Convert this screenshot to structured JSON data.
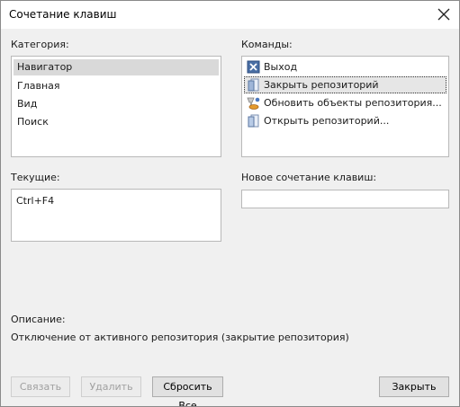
{
  "window": {
    "title": "Сочетание клавиш"
  },
  "category": {
    "label": "Категория:",
    "items": [
      "Навигатор",
      "Главная",
      "Вид",
      "Поиск"
    ],
    "selected_index": 0
  },
  "commands": {
    "label": "Команды:",
    "items": [
      {
        "label": "Выход",
        "icon": "exit-icon"
      },
      {
        "label": "Закрыть репозиторий",
        "icon": "close-repository-icon"
      },
      {
        "label": "Обновить объекты репозитория...",
        "icon": "refresh-repository-icon"
      },
      {
        "label": "Открыть репозиторий...",
        "icon": "open-repository-icon"
      }
    ],
    "focused_index": 1
  },
  "current": {
    "label": "Текущие:",
    "values": [
      "Ctrl+F4"
    ]
  },
  "new_shortcut": {
    "label": "Новое сочетание клавиш:",
    "value": ""
  },
  "description": {
    "label": "Описание:",
    "text": "Отключение от активного репозитория (закрытие репозитория)"
  },
  "buttons": {
    "assign": "Связать",
    "remove": "Удалить",
    "reset_all": "Сбросить Все",
    "close": "Закрыть"
  }
}
